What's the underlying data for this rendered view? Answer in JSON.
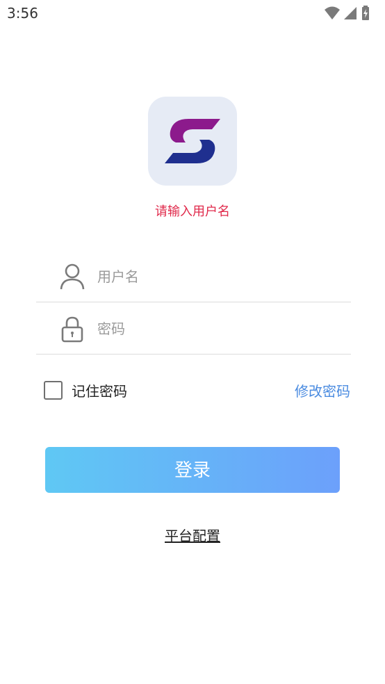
{
  "status_bar": {
    "time": "3:56",
    "icons": [
      "wifi-icon",
      "signal-icon",
      "battery-charging-icon"
    ]
  },
  "logo": {
    "icon": "app-logo",
    "colors": {
      "background": "#e6ebf5",
      "top": "#8c1a8c",
      "bottom": "#1f2f8f"
    }
  },
  "hint": "请输入用户名",
  "username": {
    "icon": "user-icon",
    "placeholder": "用户名",
    "value": ""
  },
  "password": {
    "icon": "lock-icon",
    "placeholder": "密码",
    "value": ""
  },
  "remember": {
    "label": "记住密码",
    "checked": false
  },
  "change_password_label": "修改密码",
  "login_label": "登录",
  "platform_config_label": "平台配置",
  "colors": {
    "hint": "#e0284a",
    "link": "#4a8be0",
    "button_gradient_start": "#5fc8f4",
    "button_gradient_end": "#6ca0fb"
  }
}
